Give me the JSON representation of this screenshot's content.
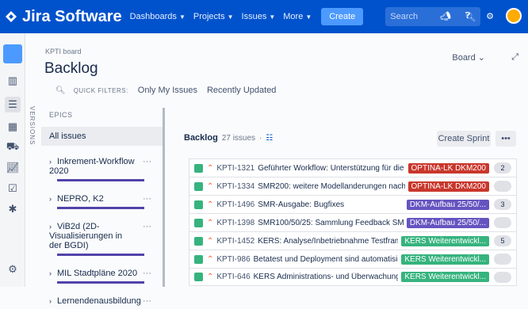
{
  "nav": {
    "product": "Jira Software",
    "items": [
      "Dashboards",
      "Projects",
      "Issues",
      "More"
    ],
    "create_label": "Create",
    "search_placeholder": "Search"
  },
  "breadcrumb": "KPTI board",
  "page_title": "Backlog",
  "board_button": "Board",
  "quick_filters": {
    "label": "QUICK FILTERS:",
    "options": [
      "Only My Issues",
      "Recently Updated"
    ]
  },
  "versions_label": "VERSIONS",
  "epics": {
    "header": "EPICS",
    "all_issues": "All issues",
    "items": [
      {
        "name": "Inkrement-Workflow 2020"
      },
      {
        "name": "NEPRO, K2"
      },
      {
        "name": "ViB2d (2D-Visualisierungen in der BGDI)"
      },
      {
        "name": "MIL Stadtpläne 2020"
      },
      {
        "name": "Lernendenausbildung"
      }
    ]
  },
  "backlog": {
    "title": "Backlog",
    "count": "27 issues",
    "separator": "·",
    "create_sprint": "Create Sprint",
    "more": "•••"
  },
  "issues": [
    {
      "key": "KPTI-1321",
      "summary": "Geführter Workflow: Unterstützung für die SMR...",
      "epic": "OPTINA-LK DKM200",
      "epic_color": "#c9372c",
      "points": "2"
    },
    {
      "key": "KPTI-1334",
      "summary": "SMR200: weitere Modellanderungen nachziehen",
      "epic": "OPTINA-LK DKM200",
      "epic_color": "#c9372c",
      "points": ""
    },
    {
      "key": "KPTI-1496",
      "summary": "SMR-Ausgabe: Bugfixes",
      "epic": "DKM-Aufbau 25/50/...",
      "epic_color": "#6554c0",
      "points": "3"
    },
    {
      "key": "KPTI-1398",
      "summary": "SMR100/50/25: Sammlung Feedback SMR A...",
      "epic": "DKM-Aufbau 25/50/...",
      "epic_color": "#6554c0",
      "points": ""
    },
    {
      "key": "KPTI-1452",
      "summary": "KERS: Analyse/Inbetriebnahme Testframework",
      "epic": "KERS Weiterentwickl...",
      "epic_color": "#36b37e",
      "points": "5"
    },
    {
      "key": "KPTI-986",
      "summary": "Betatest und Deployment sind automatisiert",
      "epic": "KERS Weiterentwickl...",
      "epic_color": "#36b37e",
      "points": ""
    },
    {
      "key": "KPTI-646",
      "summary": "KERS Administrations- und Überwachungsfun...",
      "epic": "KERS Weiterentwickl...",
      "epic_color": "#36b37e",
      "points": ""
    }
  ]
}
